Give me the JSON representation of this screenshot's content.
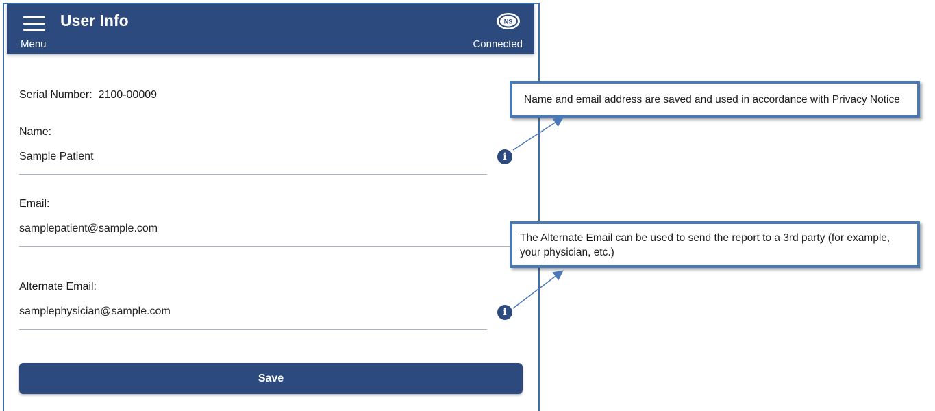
{
  "header": {
    "title": "User Info",
    "menu_label": "Menu",
    "status_label": "Connected",
    "logo_text": "NS"
  },
  "form": {
    "serial_label": "Serial Number:",
    "serial_value": "2100-00009",
    "name_label": "Name:",
    "name_value": "Sample Patient",
    "email_label": "Email:",
    "email_value": "samplepatient@sample.com",
    "alt_email_label": "Alternate Email:",
    "alt_email_value": "samplephysician@sample.com",
    "save_label": "Save",
    "info_glyph": "i"
  },
  "callouts": {
    "name_note": "Name and email address are saved and used in accordance with Privacy Notice",
    "alt_email_note": "The Alternate Email can be used to send the report to a 3rd party (for example, your physician, etc.)"
  },
  "colors": {
    "primary": "#2d4a7f",
    "callout_border": "#4a79b6"
  }
}
